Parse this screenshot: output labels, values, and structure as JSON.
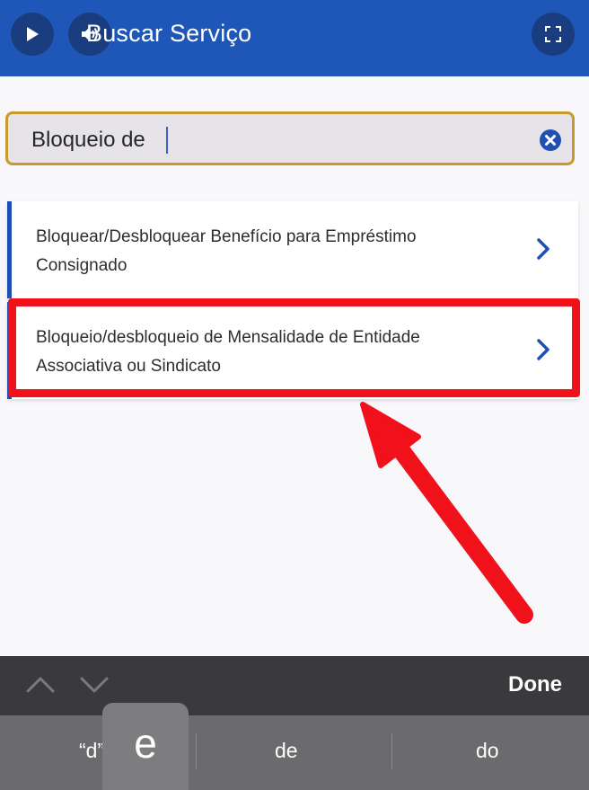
{
  "header": {
    "title": "Buscar Serviço"
  },
  "search": {
    "value": "Bloqueio de"
  },
  "results": [
    {
      "label": "Bloquear/Desbloquear Benefício para Empréstimo Consignado"
    },
    {
      "label": "Bloqueio/desbloqueio de Mensalidade de Entidade Associativa ou Sindicato"
    }
  ],
  "keyboard": {
    "done_label": "Done",
    "suggestions": [
      "“d”",
      "de",
      "do"
    ],
    "popup_key": "e"
  },
  "colors": {
    "header_bg": "#1f57b8",
    "search_border": "#c89a2e",
    "highlight_red": "#f0111b",
    "accent_blue": "#1f4fb0"
  }
}
